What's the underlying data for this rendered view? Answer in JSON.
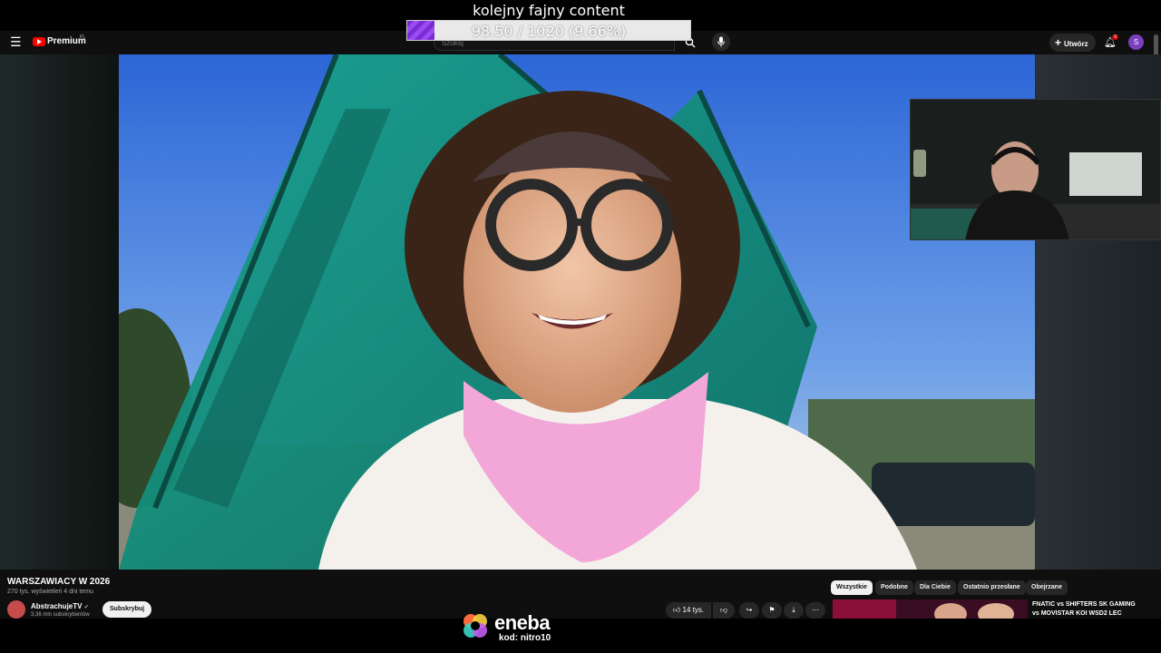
{
  "overlay": {
    "title": "kolejny fajny content",
    "progress_text": "98.50 / 1020 (9.66%)",
    "progress_fraction": 0.0966
  },
  "masthead": {
    "logo_text": "Premium",
    "logo_region": "PL",
    "search_placeholder": "Szukaj",
    "create_label": "Utwórz",
    "notification_count": "9",
    "avatar_letter": "S"
  },
  "video": {
    "title": "WARSZAWIACY W 2026",
    "meta": "270 tys. wyświetleń  4 dni temu"
  },
  "channel": {
    "name": "AbstrachujeTV",
    "verified_mark": "✔",
    "subs": "3,36 mln subskrybentów",
    "subscribe_label": "Subskrybuj"
  },
  "actions": {
    "likes": "14 tys."
  },
  "chips": [
    {
      "label": "Wszystkie",
      "active": true
    },
    {
      "label": "Podobne",
      "active": false
    },
    {
      "label": "Dla Ciebie",
      "active": false
    },
    {
      "label": "Ostatnio przesłane",
      "active": false
    },
    {
      "label": "Obejrzane",
      "active": false
    }
  ],
  "recommendation": {
    "title_line1": "FNATIC vs SHIFTERS SK GAMING",
    "title_line2": "vs MOVISTAR KOI WSD2 LEC"
  },
  "sponsor": {
    "brand": "eneba",
    "code": "kod: nitro10"
  },
  "colors": {
    "yt_red": "#ff0000",
    "accent_purple": "#7b3fbf",
    "progress_fill": "#8a3be6"
  }
}
